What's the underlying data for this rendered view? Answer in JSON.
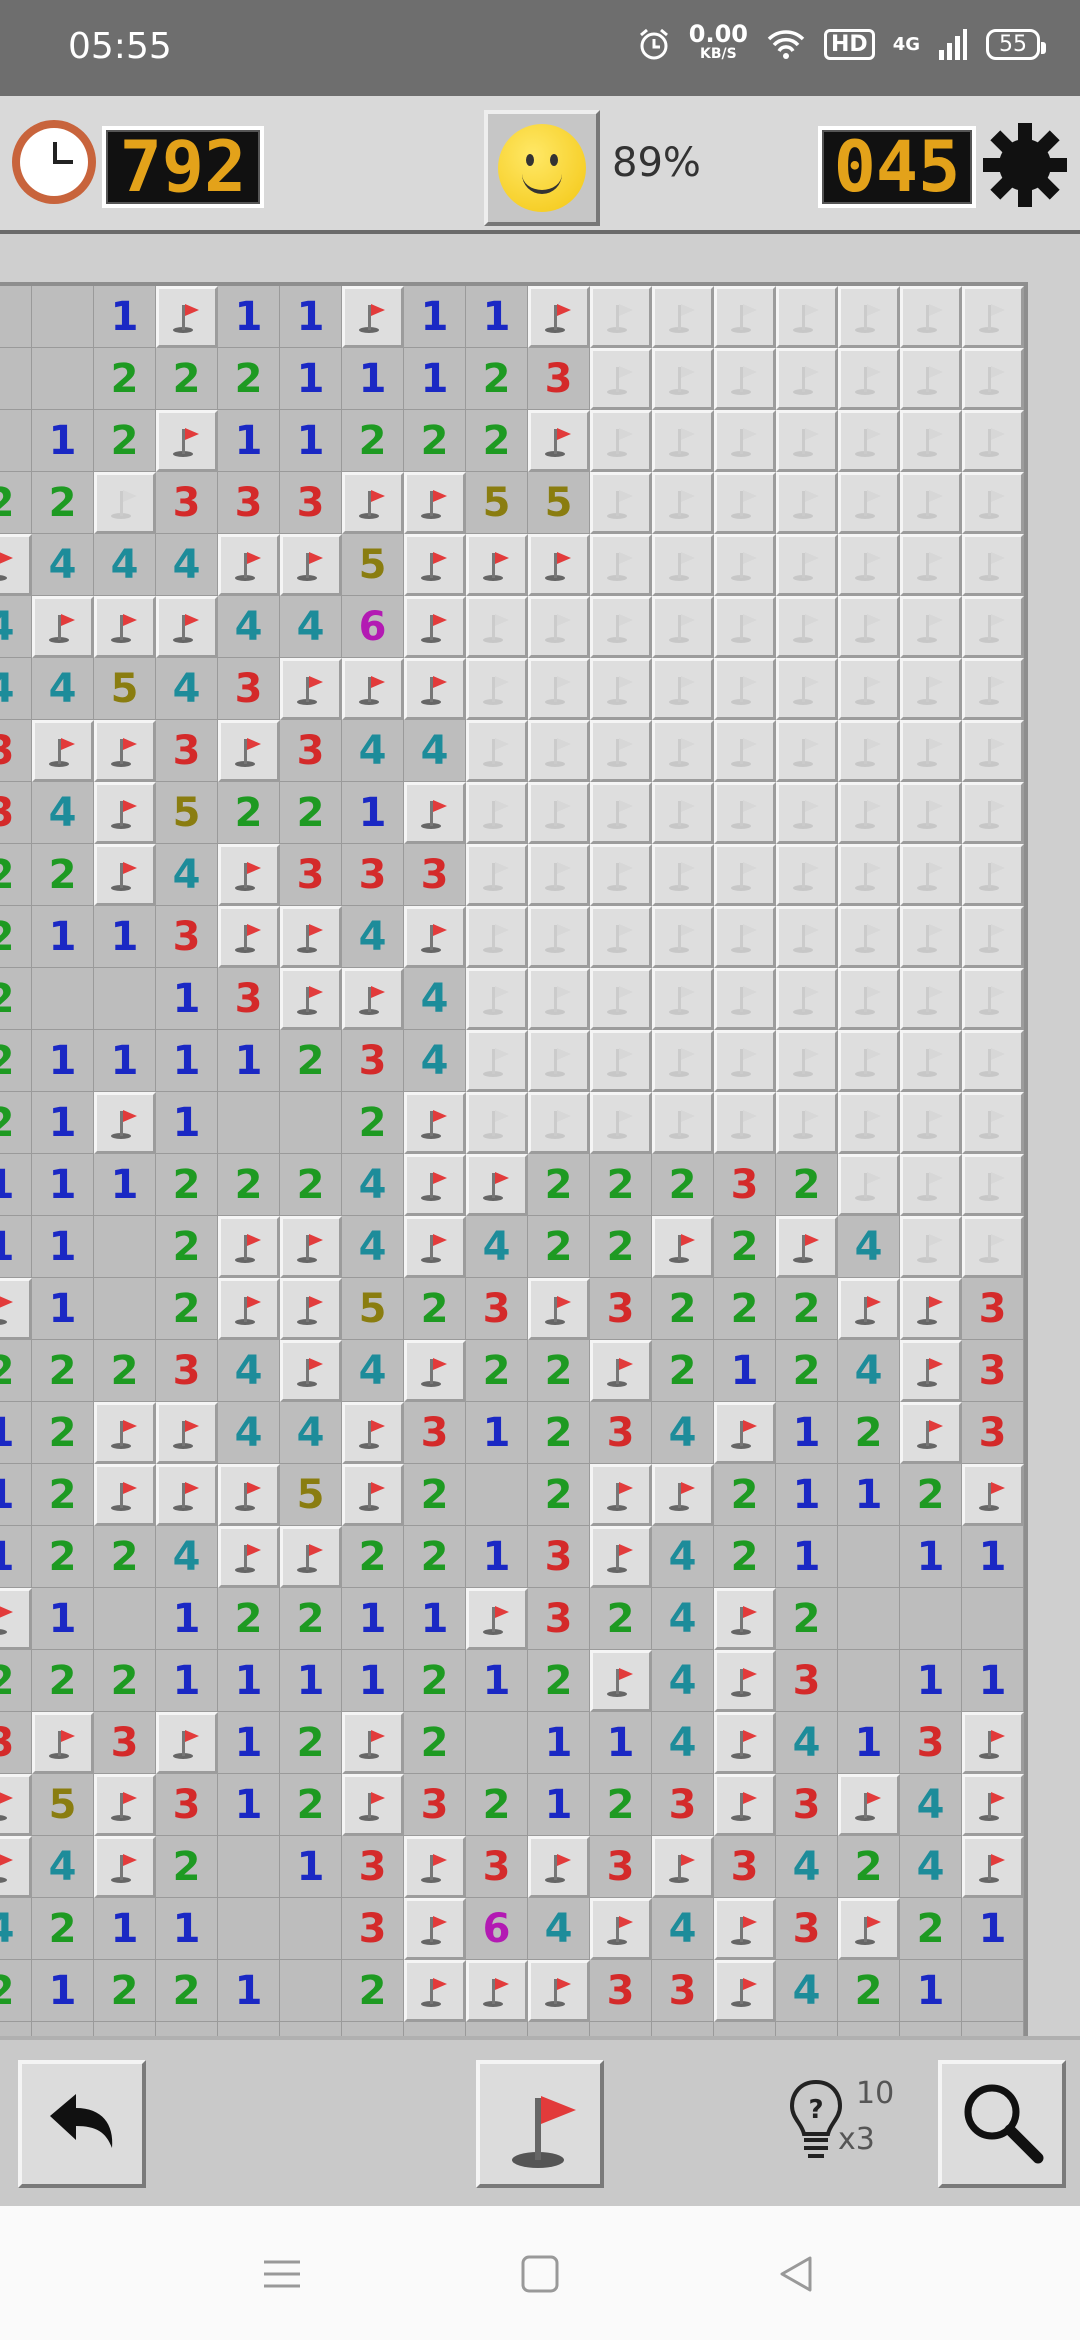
{
  "status_bar": {
    "time": "05:55",
    "net_speed": "0.00",
    "net_unit": "KB/S",
    "hd": "HD",
    "signal": "4G",
    "battery": "55"
  },
  "header": {
    "timer": "792",
    "progress": "89%",
    "mines_left": "045"
  },
  "board": {
    "rows": [
      [
        "o",
        "o",
        "1",
        "F",
        "1",
        "1",
        "F",
        "1",
        "1",
        "F",
        "U",
        "U",
        "U",
        "U",
        "U",
        "U",
        "U"
      ],
      [
        "o",
        "o",
        "2",
        "2",
        "2",
        "1",
        "1",
        "1",
        "2",
        "3",
        "U",
        "U",
        "U",
        "U",
        "U",
        "U",
        "U"
      ],
      [
        "o",
        "1",
        "2",
        "F",
        "1",
        "1",
        "2",
        "2",
        "2",
        "F",
        "U",
        "U",
        "U",
        "U",
        "U",
        "U",
        "U"
      ],
      [
        "2",
        "2",
        "U",
        "3",
        "3",
        "3",
        "F",
        "F",
        "5",
        "5",
        "U",
        "U",
        "U",
        "U",
        "U",
        "U",
        "U"
      ],
      [
        "F",
        "4",
        "4",
        "4",
        "F",
        "F",
        "5",
        "F",
        "F",
        "F",
        "U",
        "U",
        "U",
        "U",
        "U",
        "U",
        "U"
      ],
      [
        "4",
        "F",
        "F",
        "F",
        "4",
        "4",
        "6",
        "F",
        "U",
        "U",
        "U",
        "U",
        "U",
        "U",
        "U",
        "U",
        "U"
      ],
      [
        "4",
        "4",
        "5",
        "4",
        "3",
        "F",
        "F",
        "F",
        "U",
        "U",
        "U",
        "U",
        "U",
        "U",
        "U",
        "U",
        "U"
      ],
      [
        "3",
        "F",
        "F",
        "3",
        "F",
        "3",
        "4",
        "4",
        "U",
        "U",
        "U",
        "U",
        "U",
        "U",
        "U",
        "U",
        "U"
      ],
      [
        "3",
        "4",
        "F",
        "5",
        "2",
        "2",
        "1",
        "F",
        "U",
        "U",
        "U",
        "U",
        "U",
        "U",
        "U",
        "U",
        "U"
      ],
      [
        "2",
        "2",
        "F",
        "4",
        "F",
        "3",
        "3",
        "3",
        "U",
        "U",
        "U",
        "U",
        "U",
        "U",
        "U",
        "U",
        "U"
      ],
      [
        "2",
        "1",
        "1",
        "3",
        "F",
        "F",
        "4",
        "F",
        "U",
        "U",
        "U",
        "U",
        "U",
        "U",
        "U",
        "U",
        "U"
      ],
      [
        "2",
        "o",
        "o",
        "1",
        "3",
        "F",
        "F",
        "4",
        "U",
        "U",
        "U",
        "U",
        "U",
        "U",
        "U",
        "U",
        "U"
      ],
      [
        "2",
        "1",
        "1",
        "1",
        "1",
        "2",
        "3",
        "4",
        "U",
        "U",
        "U",
        "U",
        "U",
        "U",
        "U",
        "U",
        "U"
      ],
      [
        "2",
        "1",
        "F",
        "1",
        "o",
        "o",
        "2",
        "F",
        "U",
        "U",
        "U",
        "U",
        "U",
        "U",
        "U",
        "U",
        "U"
      ],
      [
        "1",
        "1",
        "1",
        "2",
        "2",
        "2",
        "4",
        "F",
        "F",
        "2",
        "2",
        "2",
        "3",
        "2",
        "U",
        "U",
        "U"
      ],
      [
        "1",
        "1",
        "o",
        "2",
        "F",
        "F",
        "4",
        "F",
        "4",
        "2",
        "2",
        "F",
        "2",
        "F",
        "4",
        "U",
        "U"
      ],
      [
        "F",
        "1",
        "o",
        "2",
        "F",
        "F",
        "5",
        "2",
        "3",
        "F",
        "3",
        "2",
        "2",
        "2",
        "F",
        "F",
        "3"
      ],
      [
        "2",
        "2",
        "2",
        "3",
        "4",
        "F",
        "4",
        "F",
        "2",
        "2",
        "F",
        "2",
        "1",
        "2",
        "4",
        "F",
        "3"
      ],
      [
        "1",
        "2",
        "F",
        "F",
        "4",
        "4",
        "F",
        "3",
        "1",
        "2",
        "3",
        "4",
        "F",
        "1",
        "2",
        "F",
        "3"
      ],
      [
        "1",
        "2",
        "F",
        "F",
        "F",
        "5",
        "F",
        "2",
        "o",
        "2",
        "F",
        "F",
        "2",
        "1",
        "1",
        "2",
        "F"
      ],
      [
        "1",
        "2",
        "2",
        "4",
        "F",
        "F",
        "2",
        "2",
        "1",
        "3",
        "F",
        "4",
        "2",
        "1",
        "o",
        "1",
        "1"
      ],
      [
        "F",
        "1",
        "o",
        "1",
        "2",
        "2",
        "1",
        "1",
        "F",
        "3",
        "2",
        "4",
        "F",
        "2",
        "o",
        "o",
        "o"
      ],
      [
        "2",
        "2",
        "2",
        "1",
        "1",
        "1",
        "1",
        "2",
        "1",
        "2",
        "F",
        "4",
        "F",
        "3",
        "o",
        "1",
        "1"
      ],
      [
        "3",
        "F",
        "3",
        "F",
        "1",
        "2",
        "F",
        "2",
        "o",
        "1",
        "1",
        "4",
        "F",
        "4",
        "1",
        "3",
        "F"
      ],
      [
        "F",
        "5",
        "F",
        "3",
        "1",
        "2",
        "F",
        "3",
        "2",
        "1",
        "2",
        "3",
        "F",
        "3",
        "F",
        "4",
        "F"
      ],
      [
        "F",
        "4",
        "F",
        "2",
        "o",
        "1",
        "3",
        "F",
        "3",
        "F",
        "3",
        "F",
        "3",
        "4",
        "2",
        "4",
        "F"
      ],
      [
        "4",
        "2",
        "1",
        "1",
        "o",
        "o",
        "3",
        "F",
        "6",
        "4",
        "F",
        "4",
        "F",
        "3",
        "F",
        "2",
        "1"
      ],
      [
        "2",
        "1",
        "2",
        "2",
        "1",
        "o",
        "2",
        "F",
        "F",
        "F",
        "3",
        "3",
        "F",
        "4",
        "2",
        "1",
        "o"
      ],
      [
        "o",
        "o",
        "o",
        "o",
        "o",
        "o",
        "o",
        "o",
        "o",
        "o",
        "o",
        "o",
        "o",
        "o",
        "o",
        "o",
        "o"
      ]
    ]
  },
  "toolbar": {
    "hint_count": "10",
    "hint_multiplier": "x3"
  },
  "colors": {
    "lcd_digits": "#e3a21a",
    "flag": "#e23b3b"
  }
}
